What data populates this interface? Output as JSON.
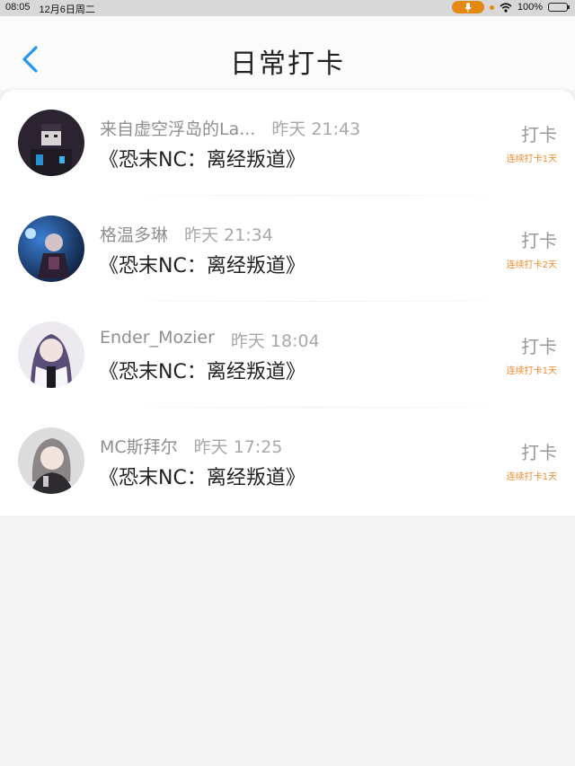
{
  "status_bar": {
    "time": "08:05",
    "date": "12月6日周二",
    "battery": "100%",
    "accent_color": "#e48a12"
  },
  "header": {
    "title": "日常打卡",
    "back_icon": "chevron-left-icon",
    "back_color": "#2196f3"
  },
  "entries": [
    {
      "user": "来自虚空浮岛的La...",
      "time": "昨天 21:43",
      "book": "《恐末NC：离经叛道》",
      "action": "打卡",
      "streak": "连续打卡1天"
    },
    {
      "user": "格温多琳",
      "time": "昨天 21:34",
      "book": "《恐末NC：离经叛道》",
      "action": "打卡",
      "streak": "连续打卡2天"
    },
    {
      "user": "Ender_Mozier",
      "time": "昨天 18:04",
      "book": "《恐末NC：离经叛道》",
      "action": "打卡",
      "streak": "连续打卡1天"
    },
    {
      "user": "MC斯拜尔",
      "time": "昨天 17:25",
      "book": "《恐末NC：离经叛道》",
      "action": "打卡",
      "streak": "连续打卡1天"
    }
  ],
  "colors": {
    "streak": "#f08a2c",
    "background": "#f5f4f4"
  }
}
